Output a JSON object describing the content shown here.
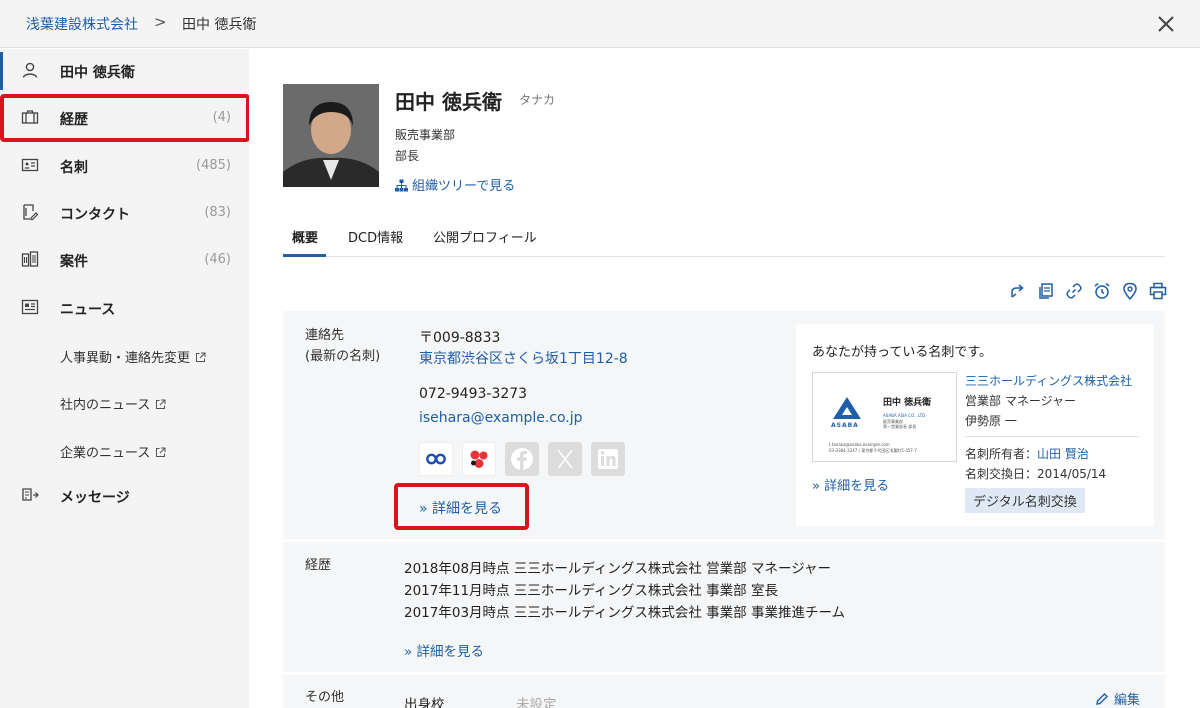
{
  "header": {
    "company": "浅葉建設株式会社",
    "separator": ">",
    "person": "田中 徳兵衛"
  },
  "sidebar": {
    "person": "田中 徳兵衛",
    "items": [
      {
        "label": "経歴",
        "count": "(4)"
      },
      {
        "label": "名刺",
        "count": "(485)"
      },
      {
        "label": "コンタクト",
        "count": "(83)"
      },
      {
        "label": "案件",
        "count": "(46)"
      },
      {
        "label": "ニュース",
        "count": ""
      },
      {
        "label": "メッセージ",
        "count": ""
      }
    ],
    "news": [
      "人事異動・連絡先変更",
      "社内のニュース",
      "企業のニュース"
    ]
  },
  "profile": {
    "name": "田中 徳兵衛",
    "kana": "タナカ",
    "department": "販売事業部",
    "title": "部長",
    "org_tree_link": "組織ツリーで見る"
  },
  "tabs": [
    "概要",
    "DCD情報",
    "公開プロフィール"
  ],
  "contact": {
    "label_line1": "連絡先",
    "label_line2": "(最新の名刺)",
    "postal": "〒009-8833",
    "address": "東京都渋谷区さくら坂1丁目12-8",
    "phone": "072-9493-3273",
    "email": "isehara@example.co.jp",
    "details_link": "» 詳細を見る"
  },
  "card": {
    "heading": "あなたが持っている名刺です。",
    "company": "三三ホールディングス株式会社",
    "dept_title": "営業部 マネージャー",
    "person": "伊勢原 一",
    "owner_label": "名刺所有者：",
    "owner_name": "山田 賢治",
    "exchange_date": "名刺交換日：2014/05/14",
    "details_link": "» 詳細を見る",
    "tag": "デジタル名刺交換",
    "card_name": "田中 徳兵衛",
    "card_brand": "ASABA",
    "card_company": "ASABA ASIA CO., LTD",
    "card_dept": "販売事業部",
    "card_sub": "第一営業部長 部長",
    "card_email": "t.tanaka@asaba.example.com",
    "card_addr": "03-3384-3247 / 東京都千代田区浅葉町5-357-7"
  },
  "history": {
    "label": "経歴",
    "entries": [
      "2018年08月時点 三三ホールディングス株式会社 営業部 マネージャー",
      "2017年11月時点 三三ホールディングス株式会社 事業部 室長",
      "2017年03月時点 三三ホールディングス株式会社 事業部 事業推進チーム"
    ],
    "details_link": "» 詳細を見る"
  },
  "other": {
    "label": "その他",
    "school_label": "出身校",
    "school_value": "未設定",
    "edit": "編集"
  },
  "colors": {
    "link": "#1f5fa8",
    "highlight": "#d8141f",
    "sidebar_bg": "#f4f4f4",
    "panel_bg": "#f5f6f7",
    "tag_bg": "#dfe9f5"
  }
}
